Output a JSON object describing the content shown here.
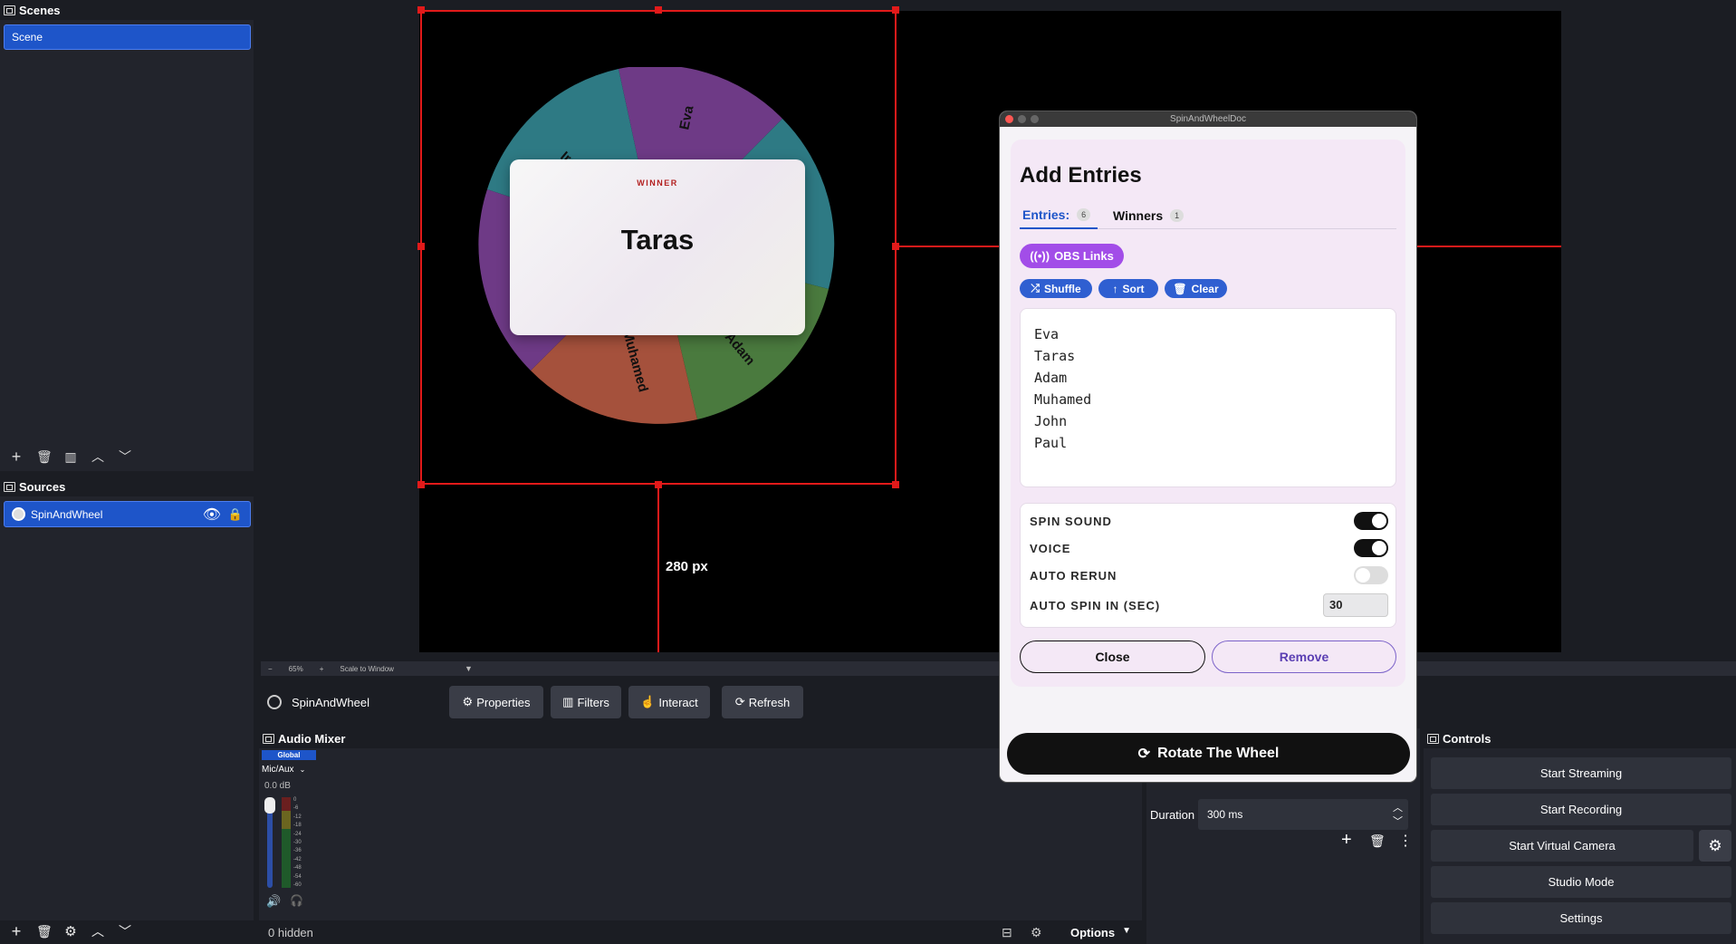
{
  "scenes": {
    "title": "Scenes",
    "items": [
      "Scene"
    ]
  },
  "sources": {
    "title": "Sources",
    "items": [
      "SpinAndWheel"
    ]
  },
  "preview": {
    "zoom": "65%",
    "scale_label": "Scale to Window",
    "measure_label": "280 px",
    "wheel": {
      "winner_label": "WINNER",
      "winner_name": "Taras",
      "segment_labels": [
        "Eva",
        "Ira",
        "Muhamed",
        "Adam"
      ]
    }
  },
  "source_bar": {
    "name": "SpinAndWheel",
    "buttons": {
      "properties": "Properties",
      "filters": "Filters",
      "interact": "Interact",
      "refresh": "Refresh"
    }
  },
  "audio_mixer": {
    "title": "Audio Mixer",
    "global_label": "Global",
    "channel": "Mic/Aux",
    "db": "0.0 dB",
    "meter_ticks": [
      "0",
      "-6",
      "-12",
      "-18",
      "-24",
      "-30",
      "-36",
      "-42",
      "-48",
      "-54",
      "-60"
    ],
    "hidden_count": "0 hidden",
    "options_label": "Options"
  },
  "transition": {
    "duration_label": "Duration",
    "duration_value": "300 ms"
  },
  "controls": {
    "title": "Controls",
    "buttons": [
      "Start Streaming",
      "Start Recording",
      "Start Virtual Camera",
      "Studio Mode",
      "Settings"
    ]
  },
  "dialog": {
    "window_title": "SpinAndWheelDoc",
    "heading": "Add Entries",
    "tabs": [
      {
        "label": "Entries:",
        "count": "6"
      },
      {
        "label": "Winners",
        "count": "1"
      }
    ],
    "obs_links_label": "OBS Links",
    "actions": {
      "shuffle": "Shuffle",
      "sort": "Sort",
      "clear": "Clear"
    },
    "entries_text": "Eva\nTaras\nAdam\nMuhamed\nJohn\nPaul",
    "options": {
      "spin_sound": {
        "label": "SPIN SOUND",
        "on": true
      },
      "voice": {
        "label": "VOICE",
        "on": true
      },
      "auto_rerun": {
        "label": "AUTO RERUN",
        "on": false
      },
      "auto_spin": {
        "label": "AUTO SPIN IN (SEC)",
        "value": "30"
      }
    },
    "close_label": "Close",
    "remove_label": "Remove",
    "rotate_label": "Rotate The Wheel"
  },
  "colors": {
    "accent": "#1e55c9",
    "purple": "#a24de8",
    "handle_red": "#e21a1a",
    "seg_purple": "#6e3a86",
    "seg_teal": "#2e7a84",
    "seg_green": "#4a7a3e",
    "seg_orange": "#a5513c"
  }
}
